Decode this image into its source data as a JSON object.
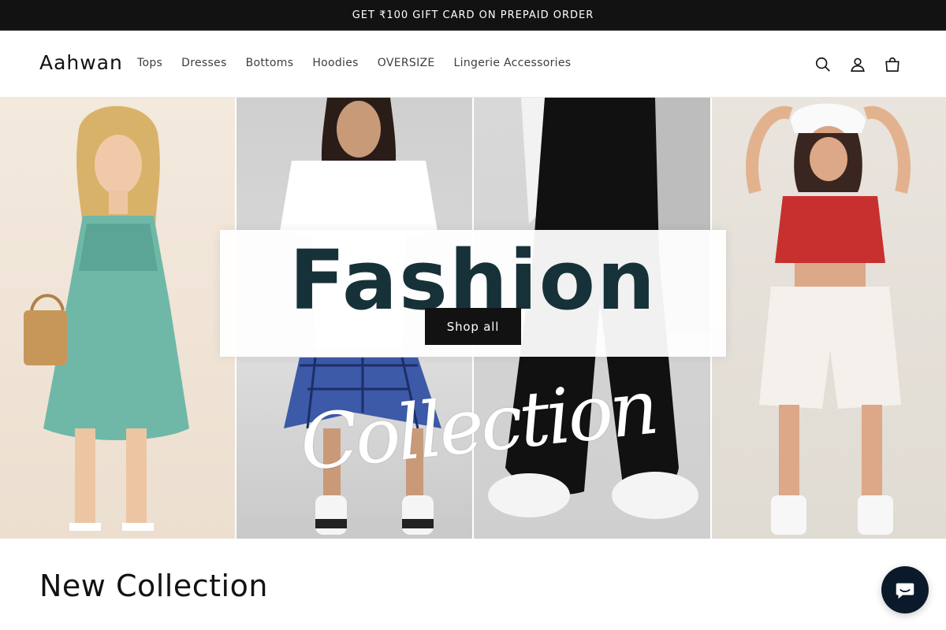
{
  "announcement": {
    "text": "GET ₹100 GIFT CARD ON PREPAID ORDER"
  },
  "header": {
    "logo": "Aahwan",
    "nav": [
      "Tops",
      "Dresses",
      "Bottoms",
      "Hoodies",
      "OVERSIZE",
      "Lingerie Accessories"
    ],
    "icons": [
      "search-icon",
      "account-icon",
      "cart-icon"
    ]
  },
  "hero": {
    "title_word": "Fashion",
    "script_word": "Collection",
    "cta_label": "Shop all"
  },
  "section": {
    "title": "New Collection"
  },
  "chat": {
    "icon": "chat-icon"
  },
  "colors": {
    "announcement_bg": "#121212",
    "text": "#121212",
    "fashion_text": "#163238",
    "chat_bg": "#0b1a2b"
  }
}
